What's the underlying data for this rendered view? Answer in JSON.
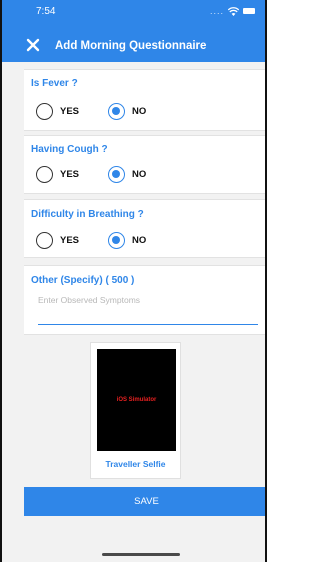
{
  "status_bar": {
    "time": "7:54",
    "signal_dots": "....",
    "icons": [
      "wifi-icon",
      "battery-icon"
    ]
  },
  "header": {
    "title": "Add Morning Questionnaire",
    "close_icon": "close-icon"
  },
  "questions": [
    {
      "title": "Is Fever ?",
      "options": [
        "YES",
        "NO"
      ],
      "selected": "NO"
    },
    {
      "title": "Having Cough ?",
      "options": [
        "YES",
        "NO"
      ],
      "selected": "NO"
    },
    {
      "title": "Difficulty in Breathing ?",
      "options": [
        "YES",
        "NO"
      ],
      "selected": "NO"
    }
  ],
  "other": {
    "title": "Other (Specify) ( 500 )",
    "placeholder": "Enter Observed Symptoms",
    "value": ""
  },
  "selfie": {
    "image_text": "iOS Simulator",
    "label": "Traveller Selfie"
  },
  "save_label": "SAVE",
  "colors": {
    "accent": "#2f86e8",
    "background": "#f2f2f2",
    "image_text": "#e82020"
  }
}
